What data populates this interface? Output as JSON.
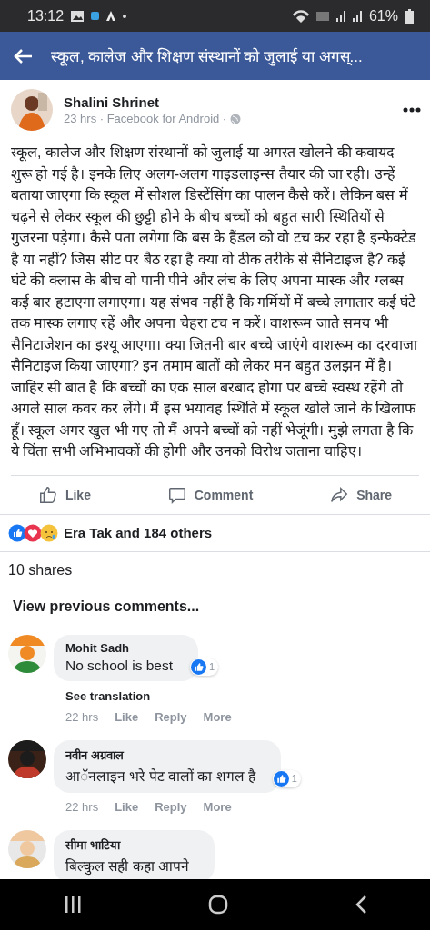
{
  "status_bar": {
    "time": "13:12",
    "battery": "61%"
  },
  "header": {
    "title": "स्कूल, कालेज और शिक्षण संस्थानों को जुलाई या अगस्..."
  },
  "post": {
    "author": "Shalini Shrinet",
    "meta": "23 hrs · Facebook for Android ·",
    "body": "स्कूल, कालेज और शिक्षण संस्थानों को जुलाई या अगस्त खोलने की कवायद शुरू हो गई है। इनके लिए अलग-अलग गाइडलाइन्स तैयार की जा रही। उन्हें बताया जाएगा कि स्कूल में सोशल डिस्टेंसिंग का पालन कैसे करें। लेकिन बस में चढ़ने से लेकर स्कूल की छुट्टी होने के बीच बच्चों को बहुत सारी स्थितियों से गुजरना पड़ेगा। कैसे पता लगेगा कि बस के हैंडल को वो टच कर रहा है इन्फेक्टेड है या नहीं? जिस सीट पर बैठ रहा है क्या वो ठीक तरीके से सैनिटाइज है? कई घंटे की क्लास के बीच वो पानी पीने और लंच के लिए अपना मास्क और ग्लब्स कई बार हटाएगा लगाएगा। यह संभव नहीं है कि गर्मियों में बच्चे लगातार कई घंटे तक मास्क लगाए रहें और अपना चेहरा टच न करें। वाशरूम जाते समय भी सैनिटाजेशन का इश्यू आएगा। क्या जितनी बार बच्चे जाएंगे वाशरूम का दरवाजा सैनिटाइज किया जाएगा? इन तमाम बातों को लेकर मन बहुत उलझन में है। जाहिर सी बात है कि बच्चों का एक साल बरबाद होगा पर बच्चे स्वस्थ रहेंगे तो अगले साल कवर कर लेंगे। मैं इस भयावह स्थिति में स्कूल खोले जाने के खिलाफ हूँ। स्कूल अगर खुल भी गए तो मैं अपने बच्चों को नहीं भेजूंगी। मुझे लगता है कि ये चिंता सभी अभिभावकों की होगी और उनको विरोध जताना चाहिए।"
  },
  "actions": [
    {
      "kind": "like",
      "label": "Like"
    },
    {
      "kind": "comment",
      "label": "Comment"
    },
    {
      "kind": "share",
      "label": "Share"
    }
  ],
  "reactions": {
    "summary": "Era Tak and 184 others"
  },
  "shares": "10 shares",
  "view_previous": "View previous comments...",
  "comments": [
    {
      "author": "Mohit Sadh",
      "text": "No school is best",
      "reaction_count": "1",
      "see_translation": "See translation",
      "time": "22 hrs",
      "links": [
        "Like",
        "Reply",
        "More"
      ]
    },
    {
      "author": "नवीन अग्रवाल",
      "text": "आॅनलाइन भरे पेट वालों का शगल है",
      "reaction_count": "1",
      "time": "22 hrs",
      "links": [
        "Like",
        "Reply",
        "More"
      ]
    },
    {
      "author": "सीमा भाटिया",
      "text": "बिल्कुल सही कहा आपने"
    }
  ]
}
